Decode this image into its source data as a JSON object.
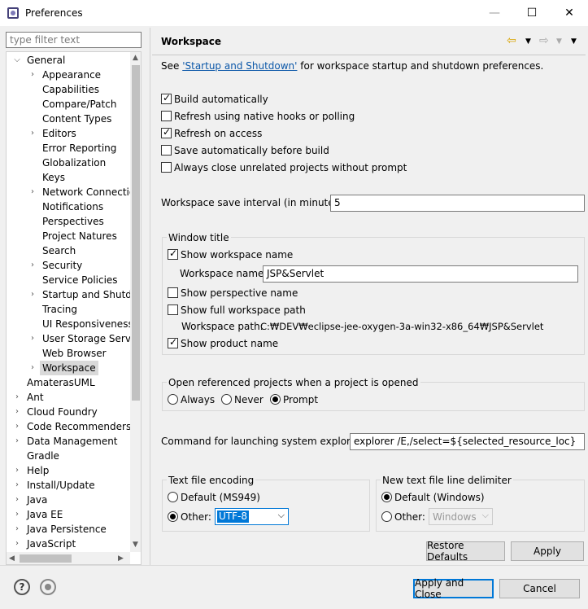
{
  "window": {
    "title": "Preferences",
    "minimize": "—",
    "maximize": "☐",
    "close": "✕"
  },
  "filter": {
    "placeholder": "type filter text"
  },
  "tree": {
    "items": [
      {
        "label": "General",
        "level": 0,
        "twisty": "expanded"
      },
      {
        "label": "Appearance",
        "level": 1,
        "twisty": "collapsed"
      },
      {
        "label": "Capabilities",
        "level": 1,
        "twisty": "none"
      },
      {
        "label": "Compare/Patch",
        "level": 1,
        "twisty": "none"
      },
      {
        "label": "Content Types",
        "level": 1,
        "twisty": "none"
      },
      {
        "label": "Editors",
        "level": 1,
        "twisty": "collapsed"
      },
      {
        "label": "Error Reporting",
        "level": 1,
        "twisty": "none"
      },
      {
        "label": "Globalization",
        "level": 1,
        "twisty": "none"
      },
      {
        "label": "Keys",
        "level": 1,
        "twisty": "none"
      },
      {
        "label": "Network Connections",
        "level": 1,
        "twisty": "collapsed"
      },
      {
        "label": "Notifications",
        "level": 1,
        "twisty": "none"
      },
      {
        "label": "Perspectives",
        "level": 1,
        "twisty": "none"
      },
      {
        "label": "Project Natures",
        "level": 1,
        "twisty": "none"
      },
      {
        "label": "Search",
        "level": 1,
        "twisty": "none"
      },
      {
        "label": "Security",
        "level": 1,
        "twisty": "collapsed"
      },
      {
        "label": "Service Policies",
        "level": 1,
        "twisty": "none"
      },
      {
        "label": "Startup and Shutdown",
        "level": 1,
        "twisty": "collapsed"
      },
      {
        "label": "Tracing",
        "level": 1,
        "twisty": "none"
      },
      {
        "label": "UI Responsiveness Monitoring",
        "level": 1,
        "twisty": "none"
      },
      {
        "label": "User Storage Service",
        "level": 1,
        "twisty": "collapsed"
      },
      {
        "label": "Web Browser",
        "level": 1,
        "twisty": "none"
      },
      {
        "label": "Workspace",
        "level": 1,
        "twisty": "collapsed",
        "selected": true
      },
      {
        "label": "AmaterasUML",
        "level": 0,
        "twisty": "none"
      },
      {
        "label": "Ant",
        "level": 0,
        "twisty": "collapsed"
      },
      {
        "label": "Cloud Foundry",
        "level": 0,
        "twisty": "collapsed"
      },
      {
        "label": "Code Recommenders",
        "level": 0,
        "twisty": "collapsed"
      },
      {
        "label": "Data Management",
        "level": 0,
        "twisty": "collapsed"
      },
      {
        "label": "Gradle",
        "level": 0,
        "twisty": "none"
      },
      {
        "label": "Help",
        "level": 0,
        "twisty": "collapsed"
      },
      {
        "label": "Install/Update",
        "level": 0,
        "twisty": "collapsed"
      },
      {
        "label": "Java",
        "level": 0,
        "twisty": "collapsed"
      },
      {
        "label": "Java EE",
        "level": 0,
        "twisty": "collapsed"
      },
      {
        "label": "Java Persistence",
        "level": 0,
        "twisty": "collapsed"
      },
      {
        "label": "JavaScript",
        "level": 0,
        "twisty": "collapsed"
      }
    ]
  },
  "page": {
    "title": "Workspace",
    "intro_before": "See ",
    "intro_link": "'Startup and Shutdown'",
    "intro_after": " for workspace startup and shutdown preferences.",
    "checkboxes": [
      {
        "label": "Build automatically",
        "checked": true
      },
      {
        "label": "Refresh using native hooks or polling",
        "checked": false
      },
      {
        "label": "Refresh on access",
        "checked": true
      },
      {
        "label": "Save automatically before build",
        "checked": false
      },
      {
        "label": "Always close unrelated projects without prompt",
        "checked": false
      }
    ],
    "save_interval_label": "Workspace save interval (in minutes):",
    "save_interval_value": "5",
    "window_title": {
      "legend": "Window title",
      "show_name_label": "Show workspace name",
      "show_name_checked": true,
      "name_label": "Workspace name:",
      "name_value": "JSP&Servlet",
      "show_perspective_label": "Show perspective name",
      "show_perspective_checked": false,
      "show_path_label": "Show full workspace path",
      "show_path_checked": false,
      "path_label": "Workspace path:",
      "path_value": "C:₩DEV₩eclipse-jee-oxygen-3a-win32-x86_64₩JSP&Servlet",
      "show_product_label": "Show product name",
      "show_product_checked": true
    },
    "open_projects": {
      "legend": "Open referenced projects when a project is opened",
      "options": [
        "Always",
        "Never",
        "Prompt"
      ],
      "selected": "Prompt"
    },
    "command_label": "Command for launching system explorer:",
    "command_value": "explorer /E,/select=${selected_resource_loc}",
    "encoding": {
      "legend": "Text file encoding",
      "default_label": "Default (MS949)",
      "other_label": "Other:",
      "selected": "Other",
      "other_value": "UTF-8"
    },
    "line_delimiter": {
      "legend": "New text file line delimiter",
      "default_label": "Default (Windows)",
      "other_label": "Other:",
      "selected": "Default",
      "other_value": "Windows"
    },
    "restore_defaults_label": "Restore Defaults",
    "apply_label": "Apply"
  },
  "footer": {
    "help_icon": "?",
    "apply_close_label": "Apply and Close",
    "cancel_label": "Cancel"
  }
}
